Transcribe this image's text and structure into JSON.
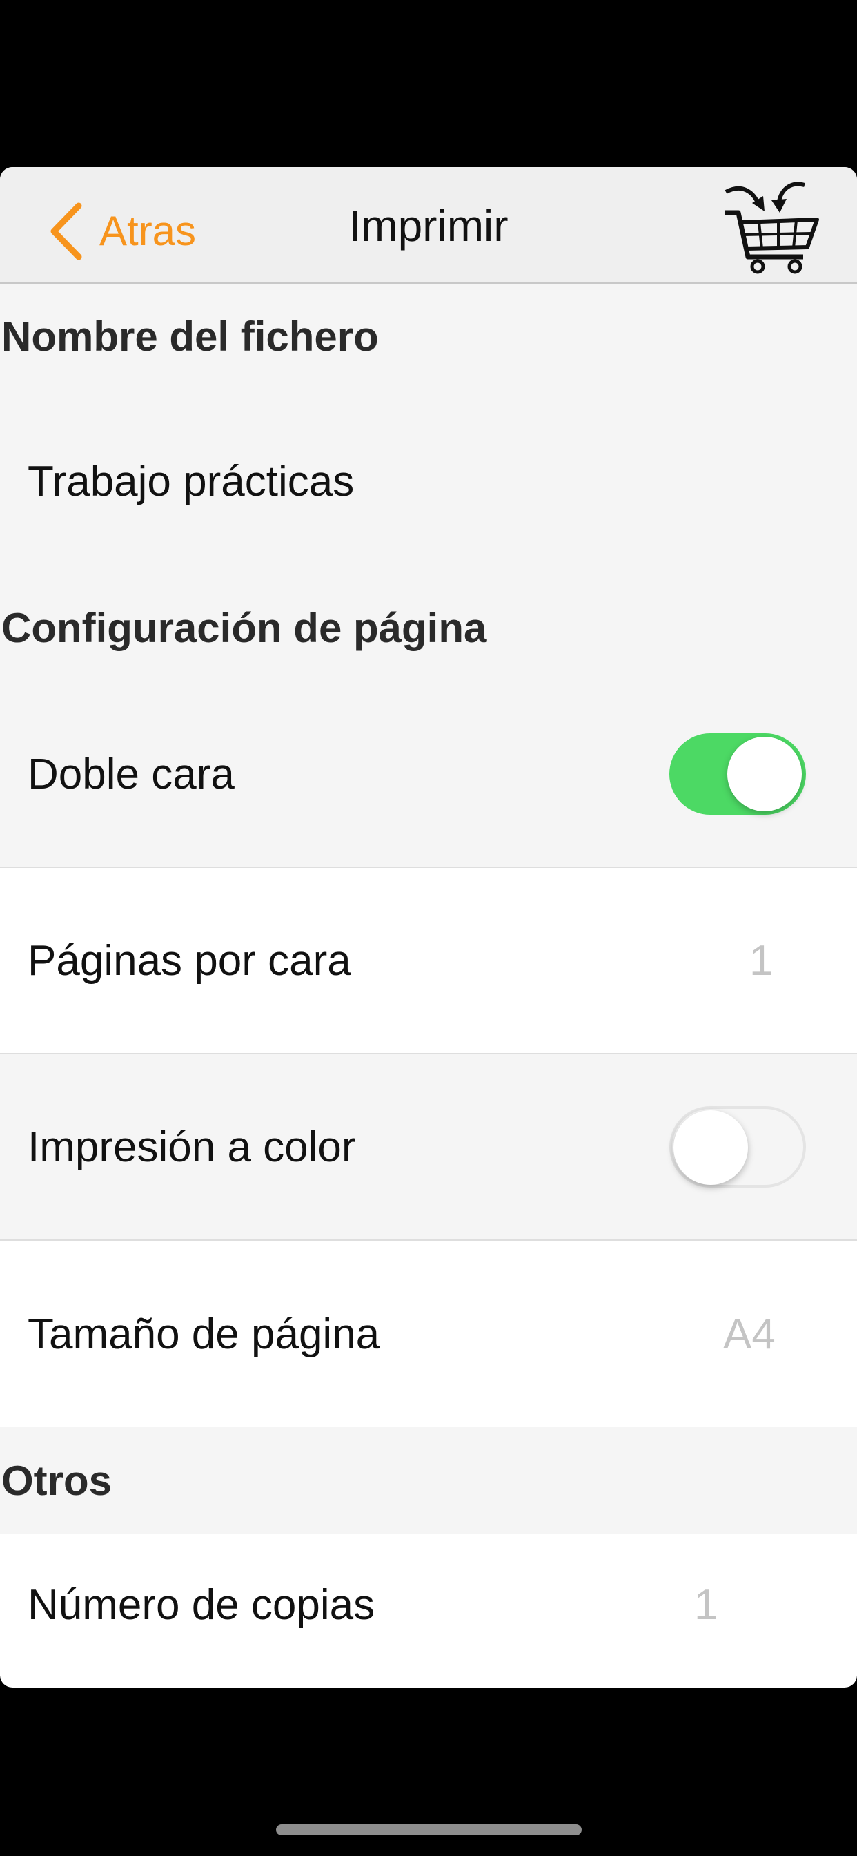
{
  "navbar": {
    "back_label": "Atras",
    "title": "Imprimir",
    "cart_icon": "cart-icon",
    "accent_color": "#f7941d"
  },
  "sections": {
    "file": {
      "header": "Nombre del fichero",
      "filename": "Trabajo prácticas"
    },
    "page_config": {
      "header": "Configuración de página",
      "double_sided": {
        "label": "Doble cara",
        "on": true
      },
      "pages_per_side": {
        "label": "Páginas por cara",
        "value": "1"
      },
      "color_print": {
        "label": "Impresión a color",
        "on": false
      },
      "page_size": {
        "label": "Tamaño de página",
        "value": "A4"
      }
    },
    "others": {
      "header": "Otros",
      "copies": {
        "label": "Número de copias",
        "value": "1"
      }
    }
  },
  "colors": {
    "toggle_on": "#4cd964",
    "value_text": "#c4c4c4"
  }
}
